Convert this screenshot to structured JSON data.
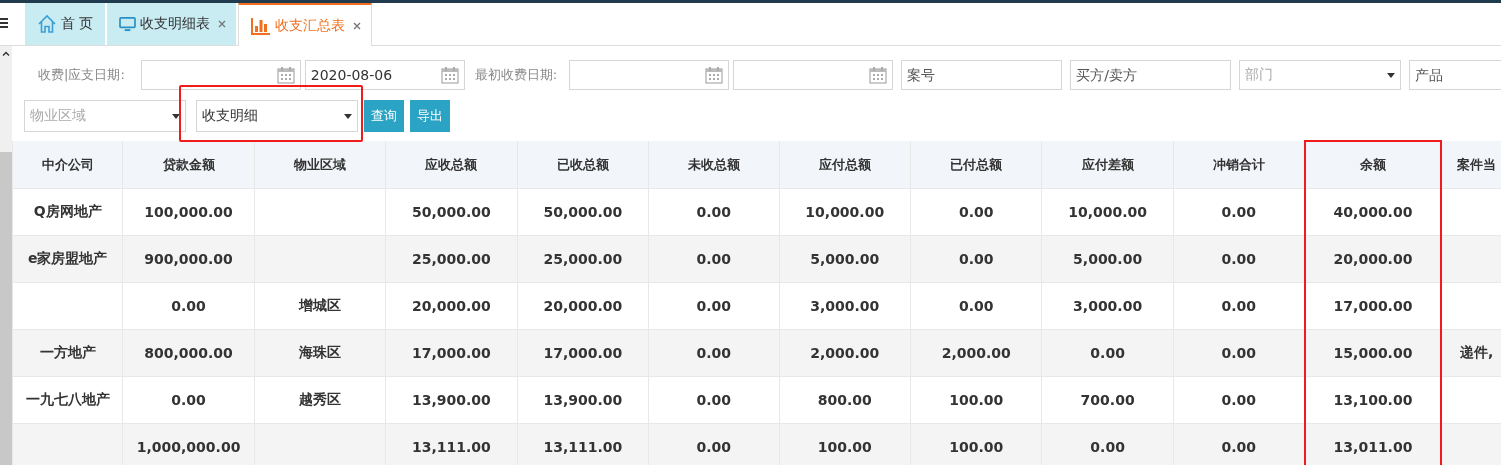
{
  "tabs": [
    {
      "kind": "home",
      "label": "首 页",
      "closable": false,
      "selected": false
    },
    {
      "kind": "monitor",
      "label": "收支明细表",
      "closable": true,
      "selected": false
    },
    {
      "kind": "chart",
      "label": "收支汇总表",
      "closable": true,
      "selected": true
    }
  ],
  "filters": [
    [
      {
        "kind": "label",
        "text": "收费|应支日期:"
      },
      {
        "kind": "date"
      },
      {
        "kind": "date",
        "value": "2020-08-06"
      },
      {
        "kind": "label",
        "text": "最初收费日期:"
      },
      {
        "kind": "date"
      },
      {
        "kind": "date"
      },
      {
        "kind": "input",
        "placeholder": "案号"
      },
      {
        "kind": "input",
        "placeholder": "买方/卖方"
      },
      {
        "kind": "select",
        "placeholder": "部门"
      },
      {
        "kind": "input",
        "placeholder": "产品"
      }
    ],
    [
      {
        "kind": "select",
        "placeholder": "物业区域"
      },
      {
        "kind": "select",
        "value": "收支明细",
        "highlighted": true
      },
      {
        "kind": "button",
        "text": "查询"
      },
      {
        "kind": "button",
        "text": "导出"
      }
    ]
  ],
  "table": {
    "columns": [
      {
        "label": "中介公司",
        "highlighted": false
      },
      {
        "label": "贷款金额",
        "highlighted": false
      },
      {
        "label": "物业区域",
        "highlighted": false
      },
      {
        "label": "应收总额",
        "highlighted": false
      },
      {
        "label": "已收总额",
        "highlighted": false
      },
      {
        "label": "未收总额",
        "highlighted": false
      },
      {
        "label": "应付总额",
        "highlighted": false
      },
      {
        "label": "已付总额",
        "highlighted": false
      },
      {
        "label": "应付差额",
        "highlighted": false
      },
      {
        "label": "冲销合计",
        "highlighted": false
      },
      {
        "label": "余额",
        "highlighted": true
      },
      {
        "label": "案件当",
        "highlighted": false
      }
    ],
    "rows": [
      [
        "Q房网地产",
        "100,000.00",
        null,
        "50,000.00",
        "50,000.00",
        "0.00",
        "10,000.00",
        "0.00",
        "10,000.00",
        "0.00",
        "40,000.00",
        null
      ],
      [
        "e家房盟地产",
        "900,000.00",
        null,
        "25,000.00",
        "25,000.00",
        "0.00",
        "5,000.00",
        "0.00",
        "5,000.00",
        "0.00",
        "20,000.00",
        null
      ],
      [
        null,
        "0.00",
        "增城区",
        "20,000.00",
        "20,000.00",
        "0.00",
        "3,000.00",
        "0.00",
        "3,000.00",
        "0.00",
        "17,000.00",
        null
      ],
      [
        "一方地产",
        "800,000.00",
        "海珠区",
        "17,000.00",
        "17,000.00",
        "0.00",
        "2,000.00",
        "2,000.00",
        "0.00",
        "0.00",
        "15,000.00",
        "递件,"
      ],
      [
        "一九七八地产",
        "0.00",
        "越秀区",
        "13,900.00",
        "13,900.00",
        "0.00",
        "800.00",
        "100.00",
        "700.00",
        "0.00",
        "13,100.00",
        null
      ],
      [
        null,
        "1,000,000.00",
        null,
        "13,111.00",
        "13,111.00",
        "0.00",
        "100.00",
        "100.00",
        "0.00",
        "0.00",
        "13,011.00",
        null
      ]
    ]
  }
}
